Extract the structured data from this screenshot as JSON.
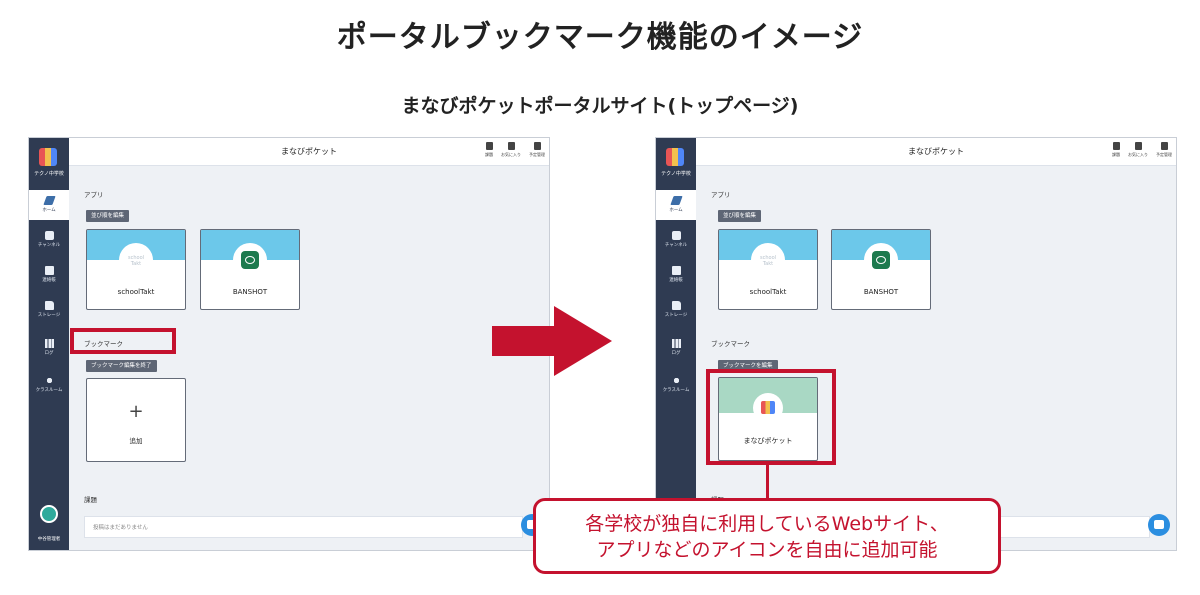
{
  "title": "ポータルブックマーク機能のイメージ",
  "subtitle": "まなびポケットポータルサイト(トップページ)",
  "app": {
    "school_name": "テクノ中学校",
    "header_title": "まなびポケット",
    "top_icons": [
      "課題",
      "お気に入り",
      "予定管理"
    ],
    "user_name": "中谷管理者",
    "nav": [
      {
        "label": "ホーム",
        "icon": "pencil-icon"
      },
      {
        "label": "チャンネル",
        "icon": "chat-icon"
      },
      {
        "label": "連絡帳",
        "icon": "document-icon"
      },
      {
        "label": "ストレージ",
        "icon": "folder-icon"
      },
      {
        "label": "ログ",
        "icon": "bar-chart-icon"
      },
      {
        "label": "クラスルーム",
        "icon": "classroom-icon"
      }
    ],
    "apps_heading": "アプリ",
    "apps_edit_button": "並び順を編集",
    "apps": [
      "schoolTakt",
      "BANSHOT"
    ],
    "schooltakt_logo_text": "school Takt",
    "bookmark_heading": "ブックマーク",
    "bookmark_edit_done_button": "ブックマーク編集を終了",
    "bookmark_edit_button": "ブックマークを編集",
    "add_plus": "+",
    "add_label": "追加",
    "bookmark_item": "まなびポケット",
    "tasks_heading": "課題",
    "tasks_empty": "投稿はまだありません"
  },
  "callout": {
    "line1": "各学校が独自に利用しているWebサイト、",
    "line2": "アプリなどのアイコンを自由に追加可能"
  },
  "colors": {
    "accent_red": "#c4122e",
    "sidebar": "#2f3b52",
    "app_card_top": "#6cc8ea",
    "bookmark_card_top": "#a9d8c4"
  }
}
